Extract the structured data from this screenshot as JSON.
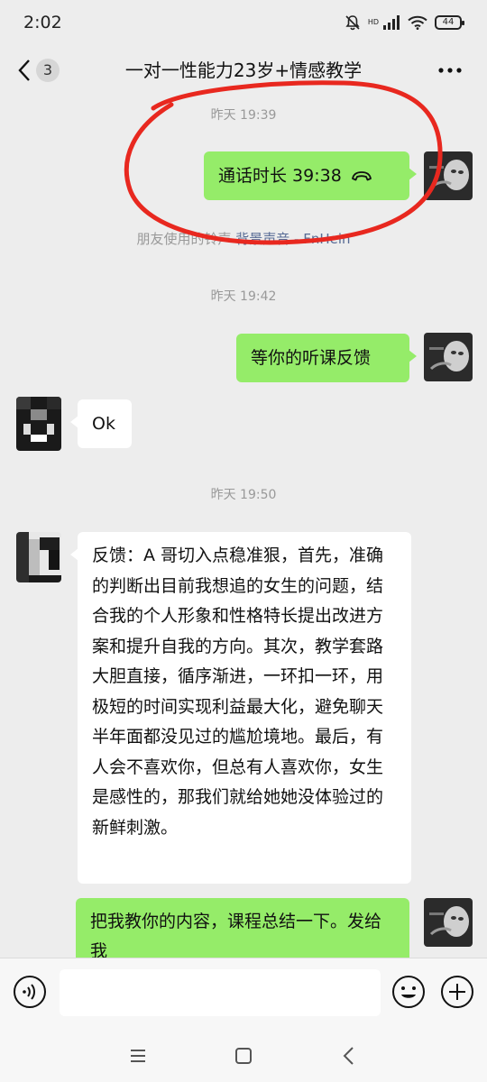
{
  "status": {
    "time": "2:02",
    "hd": "HD",
    "battery": "44"
  },
  "header": {
    "back_count": "3",
    "title": "一对一性能力23岁+情感教学"
  },
  "messages": {
    "ts1": "昨天 19:39",
    "call": {
      "text": "通话时长 39:38"
    },
    "system": {
      "prefix": "朋友使用的铃声",
      "link": "背景声音 - FnHein"
    },
    "ts2": "昨天 19:42",
    "msg1": "等你的听课反馈",
    "msg2": "Ok",
    "ts3": "昨天 19:50",
    "msg3": "反馈：A 哥切入点稳准狠，首先，准确的判断出目前我想追的女生的问题，结合我的个人形象和性格特长提出改进方案和提升自我的方向。其次，教学套路大胆直接，循序渐进，一环扣一环，用极短的时间实现利益最大化，避免聊天半年面都没见过的尴尬境地。最后，有人会不喜欢你，但总有人喜欢你，女生是感性的，那我们就给她她没体验过的新鲜刺激。",
    "msg4": "把我教你的内容，课程总结一下。发给我"
  },
  "input": {
    "value": ""
  },
  "colors": {
    "bubble_green": "#95ec69",
    "annotation_red": "#e8281f",
    "link": "#576b95"
  },
  "icons": [
    "wifi-icon",
    "signal-icon",
    "mute-icon",
    "back-icon",
    "more-icon",
    "phone-hangup-icon",
    "voice-icon",
    "emoji-icon",
    "plus-icon",
    "menu-nav-icon",
    "home-nav-icon",
    "back-nav-icon"
  ]
}
